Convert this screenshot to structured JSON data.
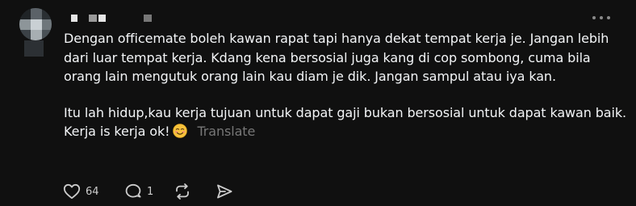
{
  "post": {
    "body_paragraphs": [
      "Dengan officemate boleh kawan rapat tapi hanya dekat tempat kerja je. Jangan lebih dari luar tempat kerja. Kdang kena bersosial juga kang di cop sombong, cuma bila orang lain mengutuk orang lain kau diam je dik. Jangan sampul atau iya kan.",
      "Itu lah hidup,kau kerja tujuan untuk dapat gaji bukan bersosial untuk dapat kawan baik. Kerja is kerja ok!"
    ],
    "emoji": "smiling-face-emoji",
    "translate_label": "Translate",
    "actions": {
      "like_count": "64",
      "reply_count": "1",
      "like_icon": "heart-icon",
      "reply_icon": "comment-icon",
      "repost_icon": "repost-icon",
      "share_icon": "share-icon"
    },
    "more_icon": "more-dots-icon",
    "avatar_blurred": true,
    "username_blurred": true
  },
  "colors": {
    "background": "#101010",
    "text": "#f3f5f7",
    "muted": "#777777"
  }
}
